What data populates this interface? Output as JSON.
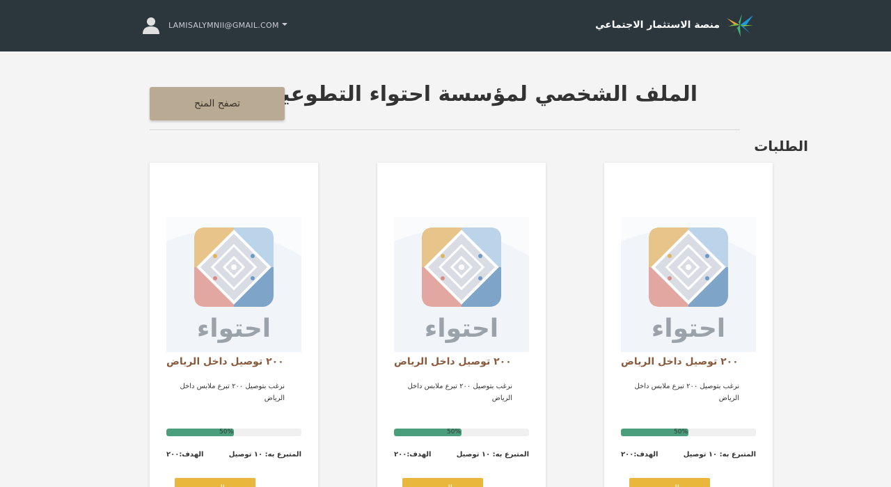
{
  "navbar": {
    "brand_name": "منصة الاستثمار الاجتماعي",
    "brand_icon": "ministry-logo",
    "user_icon": "user-avatar-icon",
    "user_email": "LAMISALYMNII@GMAIL.COM"
  },
  "header": {
    "title": "الملف الشخصي لمؤسسة احتواء التطوعية",
    "browse_button_label": "تصفح المنح"
  },
  "requests": {
    "section_title": "الطلبات",
    "items": [
      {
        "logo_text": "احتواء",
        "title": "٢٠٠ توصيل داخل الرياض",
        "description": "نرغب بتوصيل ٢٠٠ تبرع ملابس داخل الرياض",
        "progress": 50,
        "progress_label": "50%",
        "donated": "المتبرع به: ١٠ توصيل",
        "goal": "الهدف:٢٠٠",
        "more_label": "المزيد"
      },
      {
        "logo_text": "احتواء",
        "title": "٢٠٠ توصيل داخل الرياض",
        "description": "نرغب بتوصيل ٢٠٠ تبرع ملابس داخل الرياض",
        "progress": 50,
        "progress_label": "50%",
        "donated": "المتبرع به: ١٠ توصيل",
        "goal": "الهدف:٢٠٠",
        "more_label": "المزيد"
      },
      {
        "logo_text": "احتواء",
        "title": "٢٠٠ توصيل داخل الرياض",
        "description": "نرغب بتوصيل ٢٠٠ تبرع ملابس داخل الرياض",
        "progress": 50,
        "progress_label": "50%",
        "donated": "المتبرع به: ١٠ توصيل",
        "goal": "الهدف:٢٠٠",
        "more_label": "المزيد"
      }
    ]
  },
  "colors": {
    "navbar": "#2c373d",
    "browse_button": "#b8aa93",
    "progress_fill": "#4a9e7c",
    "more_button": "#e8b73c",
    "card_title": "#8a5a3c"
  }
}
